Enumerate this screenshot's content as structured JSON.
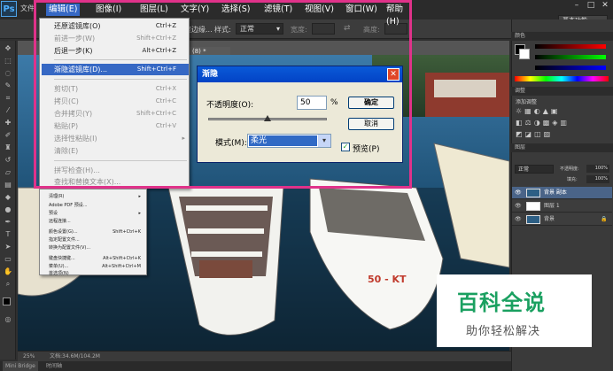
{
  "app": {
    "logo": "Ps",
    "workspace": "基本功能"
  },
  "menubar": {
    "left_items": [
      "文件"
    ],
    "items": [
      "编辑(E)",
      "图像(I)",
      "图层(L)",
      "文字(Y)",
      "选择(S)",
      "滤镜(T)",
      "视图(V)",
      "窗口(W)",
      "帮助(H)"
    ]
  },
  "options": {
    "tool_label": "样式:",
    "style_value": "正常",
    "width_label": "宽度:",
    "height_label": "高度:",
    "adjust_label": "调整边缘..."
  },
  "doc_tab": {
    "label": "(8) *"
  },
  "edit_menu": {
    "items": [
      {
        "label": "还原滤镜库(O)",
        "shortcut": "Ctrl+Z",
        "disabled": false
      },
      {
        "label": "前进一步(W)",
        "shortcut": "Shift+Ctrl+Z",
        "disabled": true
      },
      {
        "label": "后退一步(K)",
        "shortcut": "Alt+Ctrl+Z",
        "disabled": false
      },
      {
        "label": "渐隐滤镜库(D)...",
        "shortcut": "Shift+Ctrl+F",
        "disabled": false,
        "highlight": true
      },
      {
        "label": "剪切(T)",
        "shortcut": "Ctrl+X",
        "disabled": true
      },
      {
        "label": "拷贝(C)",
        "shortcut": "Ctrl+C",
        "disabled": true
      },
      {
        "label": "合并拷贝(Y)",
        "shortcut": "Shift+Ctrl+C",
        "disabled": true
      },
      {
        "label": "粘贴(P)",
        "shortcut": "Ctrl+V",
        "disabled": true
      },
      {
        "label": "选择性粘贴(I)",
        "shortcut": "",
        "disabled": true,
        "submenu": true
      },
      {
        "label": "清除(E)",
        "shortcut": "",
        "disabled": true
      },
      {
        "label": "拼写检查(H)...",
        "shortcut": "",
        "disabled": true
      },
      {
        "label": "查找和替换文本(X)...",
        "shortcut": "",
        "disabled": true
      }
    ]
  },
  "small_menu": {
    "items": [
      {
        "label": "清理(R)",
        "shortcut": ""
      },
      {
        "label": "Adobe PDF 预设...",
        "shortcut": ""
      },
      {
        "label": "预设",
        "shortcut": ""
      },
      {
        "label": "远程连接...",
        "shortcut": ""
      },
      {
        "label": "颜色设置(G)...",
        "shortcut": "Shift+Ctrl+K"
      },
      {
        "label": "指定配置文件...",
        "shortcut": ""
      },
      {
        "label": "转换为配置文件(V)...",
        "shortcut": ""
      },
      {
        "label": "键盘快捷键...",
        "shortcut": "Alt+Shift+Ctrl+K"
      },
      {
        "label": "菜单(U)...",
        "shortcut": "Alt+Shift+Ctrl+M"
      },
      {
        "label": "首选项(N)",
        "shortcut": ""
      }
    ]
  },
  "dialog": {
    "title": "渐隐",
    "opacity_label": "不透明度(O):",
    "opacity_value": "50",
    "opacity_unit": "%",
    "opacity_fraction": 0.5,
    "mode_label": "模式(M):",
    "mode_value": "柔光",
    "ok_label": "确定",
    "cancel_label": "取消",
    "preview_label": "预览(P)",
    "preview_checked": true
  },
  "right_panel": {
    "panel1_header": "颜色",
    "panel2_header": "调整",
    "adjust_label": "添加调整",
    "layers_header": "图层",
    "blend_mode": "正常",
    "opacity_label": "不透明度:",
    "opacity_value": "100%",
    "fill_label": "填充:",
    "fill_value": "100%",
    "layers": [
      {
        "name": "背景 副本",
        "selected": true
      },
      {
        "name": "图层 1",
        "selected": false
      },
      {
        "name": "背景",
        "selected": false
      }
    ]
  },
  "status": {
    "zoom": "25%",
    "doc": "文档:34.6M/104.2M"
  },
  "bottom_tabs": [
    "Mini Bridge",
    "时间轴"
  ],
  "boat_label": "50 - KT",
  "watermark": {
    "title": "百科全说",
    "subtitle": "助你轻松解决"
  },
  "colors": {
    "highlight": "#e0328a",
    "menu_selection": "#3668c4",
    "watermark_green": "#1aa060"
  }
}
